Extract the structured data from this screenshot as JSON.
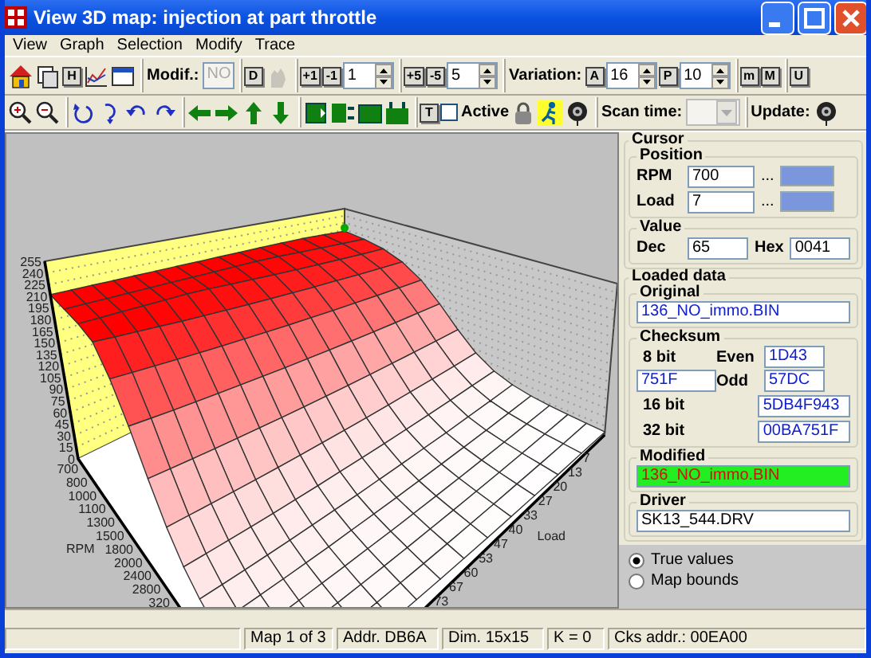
{
  "window": {
    "title": "View 3D map: injection at part throttle"
  },
  "menu": [
    "View",
    "Graph",
    "Selection",
    "Modify",
    "Trace"
  ],
  "toolbar_1": [
    {
      "kind": "icon",
      "disabled": false
    },
    {
      "kind": "icon",
      "disabled": false
    },
    {
      "kind": "key",
      "label": "H",
      "disabled": false
    },
    {
      "kind": "icon",
      "disabled": false
    },
    {
      "kind": "icon",
      "disabled": false
    },
    {
      "kind": "separator"
    },
    {
      "kind": "label",
      "text": "Modif.:"
    },
    {
      "kind": "field",
      "value": "NO",
      "disabled": true
    },
    {
      "kind": "separator"
    },
    {
      "kind": "key",
      "label": "D",
      "disabled": false
    },
    {
      "kind": "icon",
      "disabled": true
    },
    {
      "kind": "separator"
    },
    {
      "kind": "key",
      "label": "+1",
      "disabled": false
    },
    {
      "kind": "key",
      "label": "-1",
      "disabled": false
    },
    {
      "kind": "spin",
      "value": "1",
      "disabled": false
    },
    {
      "kind": "separator"
    },
    {
      "kind": "key",
      "label": "+5",
      "disabled": false
    },
    {
      "kind": "key",
      "label": "-5",
      "disabled": false
    },
    {
      "kind": "spin",
      "value": "5",
      "disabled": false
    },
    {
      "kind": "separator"
    },
    {
      "kind": "label",
      "text": "Variation:"
    },
    {
      "kind": "key",
      "label": "A",
      "disabled": false
    },
    {
      "kind": "spin",
      "value": "16",
      "disabled": false
    },
    {
      "kind": "key",
      "label": "P",
      "disabled": false
    },
    {
      "kind": "spin",
      "value": "10",
      "disabled": false
    },
    {
      "kind": "separator"
    },
    {
      "kind": "key",
      "label": "m",
      "disabled": false
    },
    {
      "kind": "key",
      "label": "M",
      "disabled": false
    },
    {
      "kind": "separator"
    },
    {
      "kind": "key",
      "label": "U",
      "disabled": false
    }
  ],
  "toolbar_2": [
    {
      "kind": "icon",
      "disabled": false
    },
    {
      "kind": "icon",
      "disabled": false
    },
    {
      "kind": "separator"
    },
    {
      "kind": "icon",
      "disabled": false
    },
    {
      "kind": "icon",
      "disabled": false
    },
    {
      "kind": "icon",
      "disabled": false
    },
    {
      "kind": "icon",
      "disabled": false
    },
    {
      "kind": "separator"
    },
    {
      "kind": "icon",
      "disabled": false
    },
    {
      "kind": "icon",
      "disabled": false
    },
    {
      "kind": "icon",
      "disabled": false
    },
    {
      "kind": "icon",
      "disabled": false
    },
    {
      "kind": "separator"
    },
    {
      "kind": "icon",
      "disabled": false
    },
    {
      "kind": "icon",
      "disabled": false
    },
    {
      "kind": "icon",
      "disabled": false
    },
    {
      "kind": "icon",
      "disabled": false
    },
    {
      "kind": "separator"
    },
    {
      "kind": "key",
      "label": "T",
      "disabled": false
    },
    {
      "kind": "checkbox",
      "label": "Active",
      "checked": false
    },
    {
      "kind": "icon",
      "disabled": false
    },
    {
      "kind": "icon",
      "disabled": false
    },
    {
      "kind": "icon",
      "disabled": false
    },
    {
      "kind": "separator"
    },
    {
      "kind": "label",
      "text": "Scan time:"
    },
    {
      "kind": "combo",
      "disabled": true
    },
    {
      "kind": "separator"
    },
    {
      "kind": "label",
      "text": "Update:"
    },
    {
      "kind": "icon",
      "disabled": false
    }
  ],
  "plot": {
    "value_ticks": [
      "255",
      "240",
      "225",
      "210",
      "195",
      "180",
      "165",
      "150",
      "135",
      "120",
      "105",
      "90",
      "75",
      "60",
      "45",
      "30",
      "15",
      "0"
    ],
    "rpm_ticks": [
      "700",
      "800",
      "1000",
      "1100",
      "1300",
      "1500",
      "1800",
      "2000",
      "2400",
      "2800",
      "320"
    ],
    "rpm_label": "RPM",
    "load_ticks": [
      "7",
      "13",
      "20",
      "27",
      "33",
      "40",
      "47",
      "53",
      "60",
      "67",
      "73"
    ],
    "load_label": "Load"
  },
  "cursor": {
    "title": "Cursor",
    "position": {
      "title": "Position",
      "rows": [
        {
          "label": "RPM",
          "value": "700",
          "dots": "..."
        },
        {
          "label": "Load",
          "value": "7",
          "dots": "..."
        }
      ]
    },
    "value": {
      "title": "Value",
      "dec_label": "Dec",
      "dec": "65",
      "hex_label": "Hex",
      "hex": "0041"
    }
  },
  "loaded_data": {
    "title": "Loaded data",
    "original": {
      "title": "Original",
      "file": "136_NO_immo.BIN"
    },
    "checksum": {
      "title": "Checksum",
      "bit8_label": "8 bit",
      "bit8": "751F",
      "even_label": "Even",
      "even": "1D43",
      "odd_label": "Odd",
      "odd": "57DC",
      "bit16_label": "16 bit",
      "bit16": "5DB4F943",
      "bit32_label": "32 bit",
      "bit32": "00BA751F"
    },
    "modified": {
      "title": "Modified",
      "file": "136_NO_immo.BIN"
    },
    "driver": {
      "title": "Driver",
      "file": "SK13_544.DRV"
    }
  },
  "display_mode": [
    {
      "label": "True values",
      "selected": true
    },
    {
      "label": "Map bounds",
      "selected": false
    }
  ],
  "status_bar": [
    "Map 1 of 3",
    "Addr. DB6A",
    "Dim. 15x15",
    "K = 0",
    "Cks addr.: 00EA00"
  ]
}
